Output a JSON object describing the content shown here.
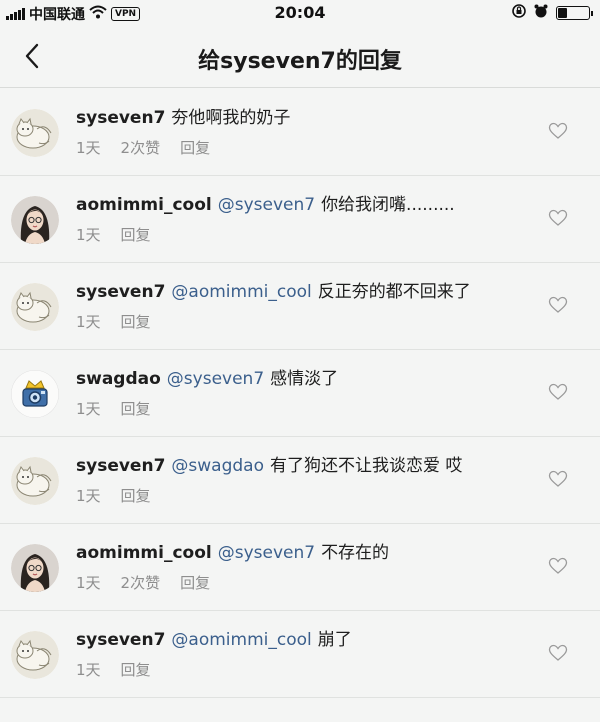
{
  "status_bar": {
    "carrier": "中国联通",
    "vpn": "VPN",
    "time": "20:04",
    "battery_level": 0.3
  },
  "header": {
    "title": "给syseven7的回复"
  },
  "comments": [
    {
      "username": "syseven7",
      "avatar": "cat",
      "mention": "",
      "text": "夯他啊我的奶子",
      "time": "1天",
      "likes": "2次赞",
      "reply": "回复"
    },
    {
      "username": "aomimmi_cool",
      "avatar": "girl",
      "mention": "@syseven7",
      "text": "你给我闭嘴.........",
      "time": "1天",
      "likes": "",
      "reply": "回复"
    },
    {
      "username": "syseven7",
      "avatar": "cat",
      "mention": "@aomimmi_cool",
      "text": "反正夯的都不回来了",
      "time": "1天",
      "likes": "",
      "reply": "回复"
    },
    {
      "username": "swagdao",
      "avatar": "crown",
      "mention": "@syseven7",
      "text": "感情淡了",
      "time": "1天",
      "likes": "",
      "reply": "回复"
    },
    {
      "username": "syseven7",
      "avatar": "cat",
      "mention": "@swagdao",
      "text": "有了狗还不让我谈恋爱 哎",
      "time": "1天",
      "likes": "",
      "reply": "回复"
    },
    {
      "username": "aomimmi_cool",
      "avatar": "girl",
      "mention": "@syseven7",
      "text": "不存在的",
      "time": "1天",
      "likes": "2次赞",
      "reply": "回复"
    },
    {
      "username": "syseven7",
      "avatar": "cat",
      "mention": "@aomimmi_cool",
      "text": "崩了",
      "time": "1天",
      "likes": "",
      "reply": "回复"
    }
  ],
  "colors": {
    "mention": "#3b5f8c",
    "meta": "#8e8e8e",
    "background": "#f4f5f4"
  }
}
